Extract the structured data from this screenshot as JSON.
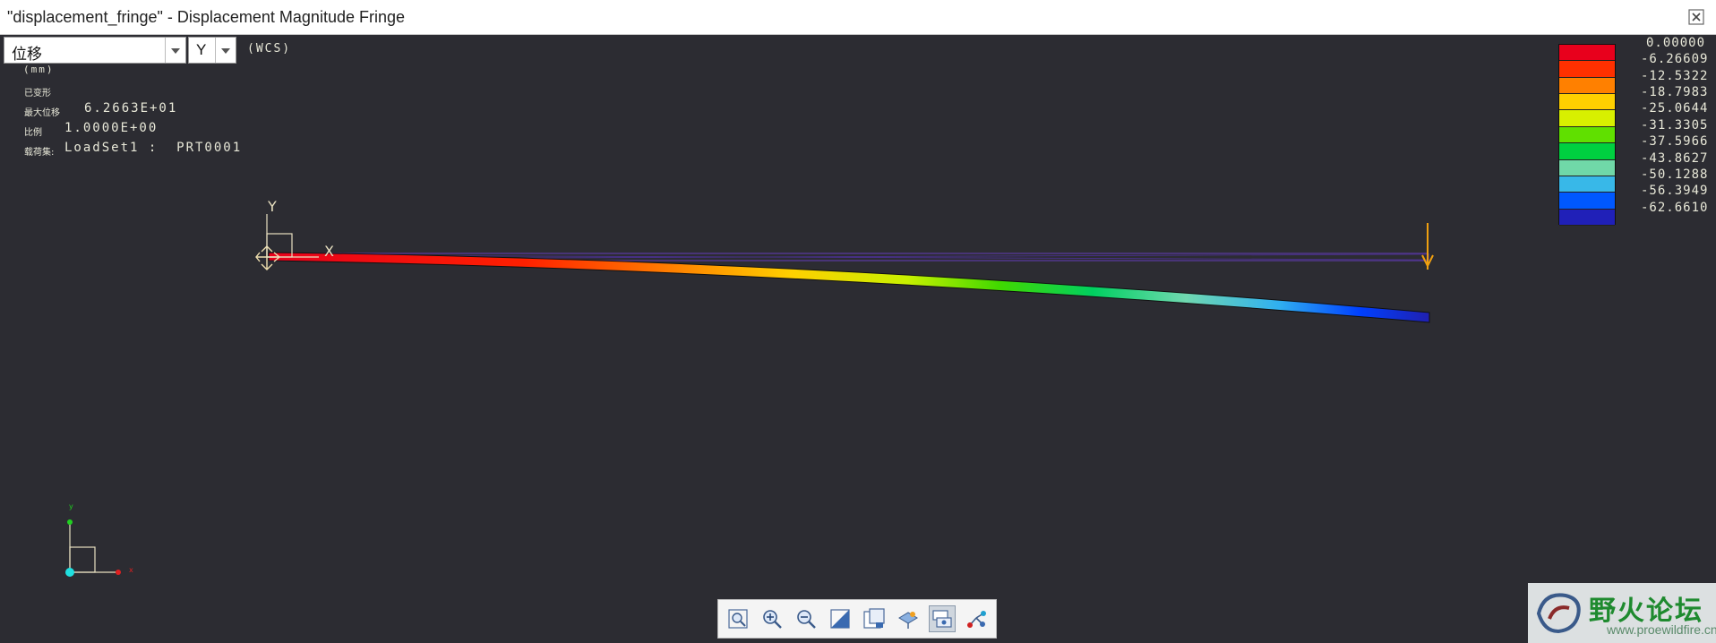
{
  "window": {
    "title": "\"displacement_fringe\" - Displacement Magnitude Fringe"
  },
  "controls": {
    "quantity_value": "位移",
    "component_value": "Y"
  },
  "info": {
    "coordinate_system": "(WCS)",
    "units": "(mm)",
    "deformed_label": "已变形",
    "max_displacement_label": "最大位移",
    "max_displacement_value": "6.2663E+01",
    "scale_label": "比例",
    "scale_value": "1.0000E+00",
    "load_set_label": "载荷集:",
    "load_set_value": "LoadSet1 :  PRT0001"
  },
  "legend": {
    "labels": [
      "0.00000",
      "-6.26609",
      "-12.5322",
      "-18.7983",
      "-25.0644",
      "-31.3305",
      "-37.5966",
      "-43.8627",
      "-50.1288",
      "-56.3949",
      "-62.6610"
    ],
    "colors": [
      "#e8001c",
      "#ff3000",
      "#ff8000",
      "#ffd000",
      "#d8f000",
      "#60e000",
      "#00d040",
      "#70d8a8",
      "#38b8e8",
      "#0058ff",
      "#2020b8"
    ]
  },
  "axes": {
    "x_label": "X",
    "y_label": "Y"
  },
  "triad": {
    "x_label": "x",
    "y_label": "y"
  },
  "toolbar": {
    "buttons": [
      "zoom-fit-icon",
      "zoom-in-icon",
      "zoom-out-icon",
      "shade-icon",
      "view-manager-icon",
      "named-view-icon",
      "display-style-icon",
      "spin-center-icon"
    ]
  },
  "watermark": {
    "title": "野火论坛",
    "url": "www.proewildfire.cn"
  }
}
